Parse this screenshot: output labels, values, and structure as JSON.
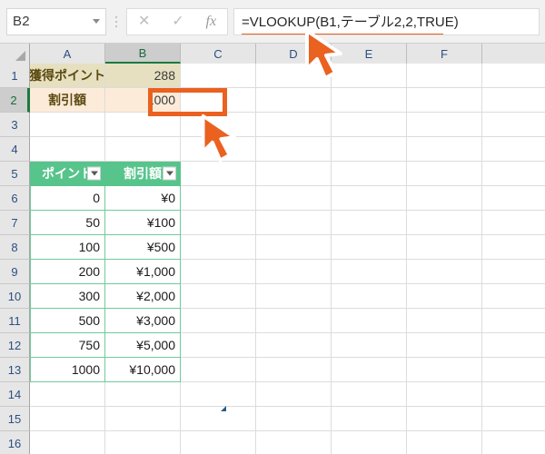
{
  "app": {
    "name": "Excel Worksheet"
  },
  "formula_bar": {
    "name_box_value": "B2",
    "cancel_label": "✕",
    "enter_label": "✓",
    "function_label": "fx",
    "formula": "=VLOOKUP(B1,テーブル2,2,TRUE)"
  },
  "grid": {
    "column_headers": [
      "A",
      "B",
      "C",
      "D",
      "E",
      "F"
    ],
    "selected_column": "B",
    "selected_row": "2",
    "row_headers": [
      "1",
      "2",
      "3",
      "4",
      "5",
      "6",
      "7",
      "8",
      "9",
      "10",
      "11",
      "12",
      "13",
      "14",
      "15",
      "16"
    ]
  },
  "summary": {
    "points_label": "獲得ポイント",
    "points_value": "288",
    "discount_label": "割引額",
    "discount_value": "1000"
  },
  "table": {
    "headers": [
      "ポイント",
      "割引額"
    ],
    "rows": [
      [
        "0",
        "¥0"
      ],
      [
        "50",
        "¥100"
      ],
      [
        "100",
        "¥500"
      ],
      [
        "200",
        "¥1,000"
      ],
      [
        "300",
        "¥2,000"
      ],
      [
        "500",
        "¥3,000"
      ],
      [
        "750",
        "¥5,000"
      ],
      [
        "1000",
        "¥10,000"
      ]
    ]
  },
  "colors": {
    "annotation": "#ea6120",
    "table_header": "#57c48c",
    "table_border": "#6fcb9a",
    "summary_row1_bg": "#e7e0c0",
    "summary_row2_bg": "#fcebd9",
    "header_bg": "#e6e6e6"
  }
}
